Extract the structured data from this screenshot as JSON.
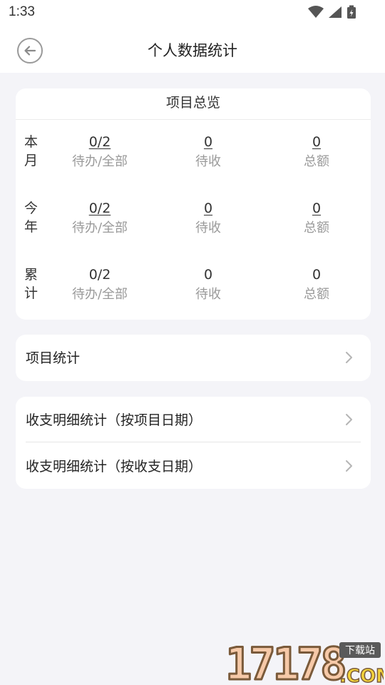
{
  "status_bar": {
    "time": "1:33"
  },
  "header": {
    "title": "个人数据统计"
  },
  "overview": {
    "title": "项目总览",
    "rows": [
      {
        "label": "本月",
        "cells": [
          {
            "value": "0/2",
            "caption": "待办/全部"
          },
          {
            "value": "0",
            "caption": "待收"
          },
          {
            "value": "0",
            "caption": "总额"
          }
        ]
      },
      {
        "label": "今年",
        "cells": [
          {
            "value": "0/2",
            "caption": "待办/全部"
          },
          {
            "value": "0",
            "caption": "待收"
          },
          {
            "value": "0",
            "caption": "总额"
          }
        ]
      },
      {
        "label": "累计",
        "cells": [
          {
            "value": "0/2",
            "caption": "待办/全部"
          },
          {
            "value": "0",
            "caption": "待收"
          },
          {
            "value": "0",
            "caption": "总额"
          }
        ]
      }
    ]
  },
  "menu": {
    "project_stats": "项目统计",
    "detail_by_project_date": "收支明细统计（按项目日期）",
    "detail_by_payment_date": "收支明细统计（按收支日期）"
  },
  "watermark": {
    "text": "17178",
    "sub": ".COM",
    "badge": "下载站"
  },
  "colors": {
    "background": "#f4f4f8",
    "card": "#ffffff",
    "muted": "#9a9a9a"
  }
}
